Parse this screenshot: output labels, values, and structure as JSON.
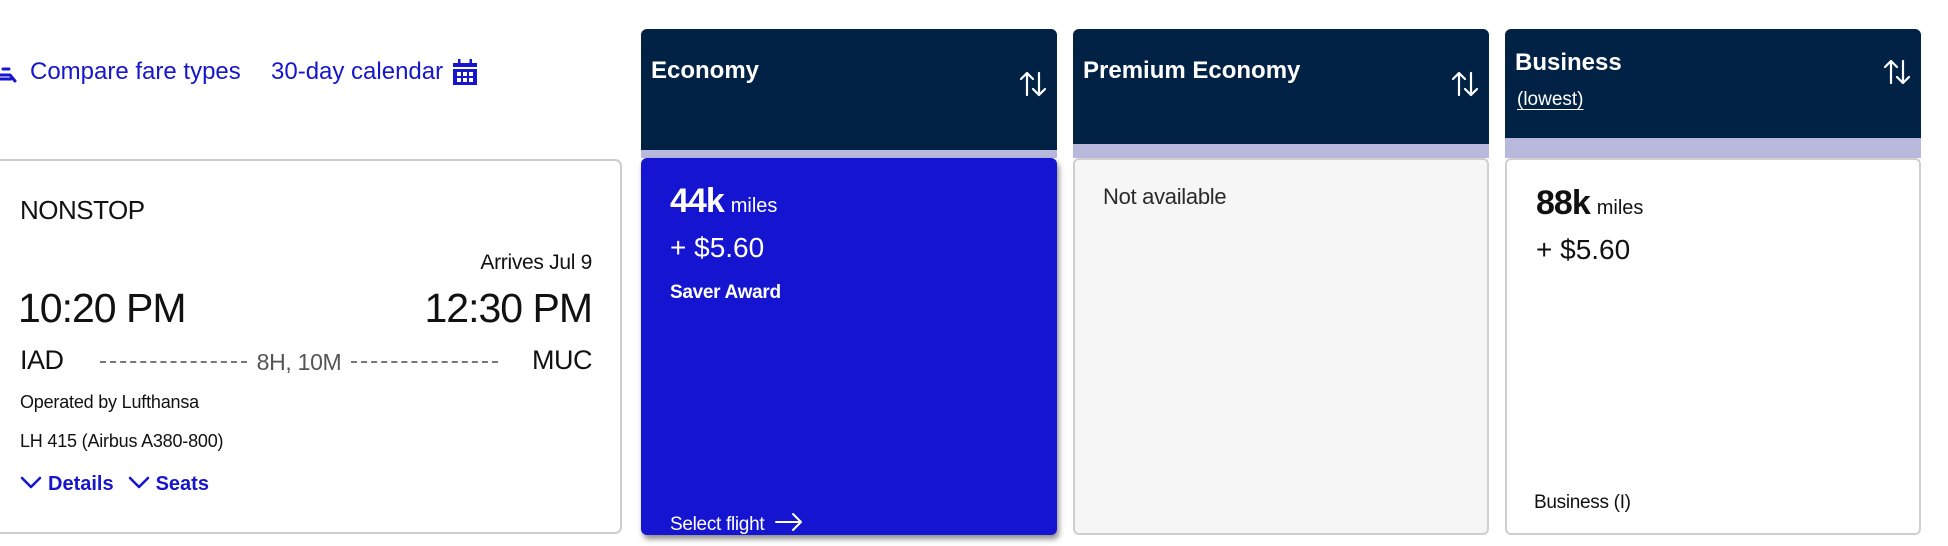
{
  "toolbar": {
    "compare_fare_types": {
      "label": "Compare fare types",
      "icon": "seat-icon"
    },
    "calendar": {
      "label": "30-day calendar",
      "icon": "calendar-icon"
    }
  },
  "colors": {
    "link": "#1616cc",
    "header_bg": "#012244",
    "strip": "#b7b8dc",
    "selected_card": "#1515d1",
    "unavailable_card": "#f6f6f6"
  },
  "flight": {
    "stops": "NONSTOP",
    "arrives_note": "Arrives Jul 9",
    "departure_time": "10:20 PM",
    "arrival_time": "12:30 PM",
    "origin": "IAD",
    "destination": "MUC",
    "duration": "8H, 10M",
    "operated_by": "Operated by Lufthansa",
    "flight_number": "LH 415 (Airbus A380-800)",
    "links": [
      {
        "label": "Details",
        "icon": "chevron-down-icon"
      },
      {
        "label": "Seats",
        "icon": "chevron-down-icon"
      }
    ]
  },
  "fares": [
    {
      "cabin": "Economy",
      "subtitle": null,
      "sort_icon": "sort-arrows-icon",
      "status": "selected",
      "miles": "44k",
      "miles_unit": "miles",
      "cash": "+ $5.60",
      "award_type": "Saver Award",
      "action": {
        "label": "Select flight",
        "icon": "arrow-right-icon"
      }
    },
    {
      "cabin": "Premium Economy",
      "subtitle": null,
      "sort_icon": "sort-arrows-icon",
      "status": "unavailable",
      "message": "Not available"
    },
    {
      "cabin": "Business",
      "subtitle": "(lowest)",
      "sort_icon": "sort-arrows-icon",
      "status": "available",
      "miles": "88k",
      "miles_unit": "miles",
      "cash": "+ $5.60",
      "cabin_code": "Business (I)"
    }
  ]
}
